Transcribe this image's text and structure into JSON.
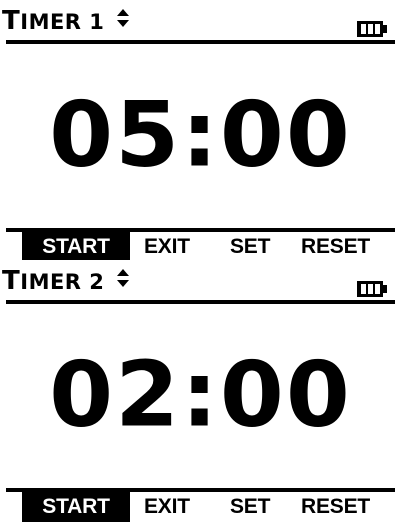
{
  "screens": [
    {
      "title": "TIMER 1",
      "title_first": "T",
      "title_rest": "IMER 1",
      "time": "05:00",
      "softkeys": {
        "start": "START",
        "exit": "EXIT",
        "set": "SET",
        "reset": "RESET"
      },
      "selected_softkey": "START",
      "battery_level": 1.0
    },
    {
      "title": "TIMER 2",
      "title_first": "T",
      "title_rest": "IMER 2",
      "time": "02:00",
      "softkeys": {
        "start": "START",
        "exit": "EXIT",
        "set": "SET",
        "reset": "RESET"
      },
      "selected_softkey": "START",
      "battery_level": 1.0
    }
  ],
  "icons": {
    "updown": "updown-arrows-icon",
    "battery": "battery-full-icon"
  },
  "colors": {
    "foreground": "#000000",
    "background": "#ffffff"
  }
}
